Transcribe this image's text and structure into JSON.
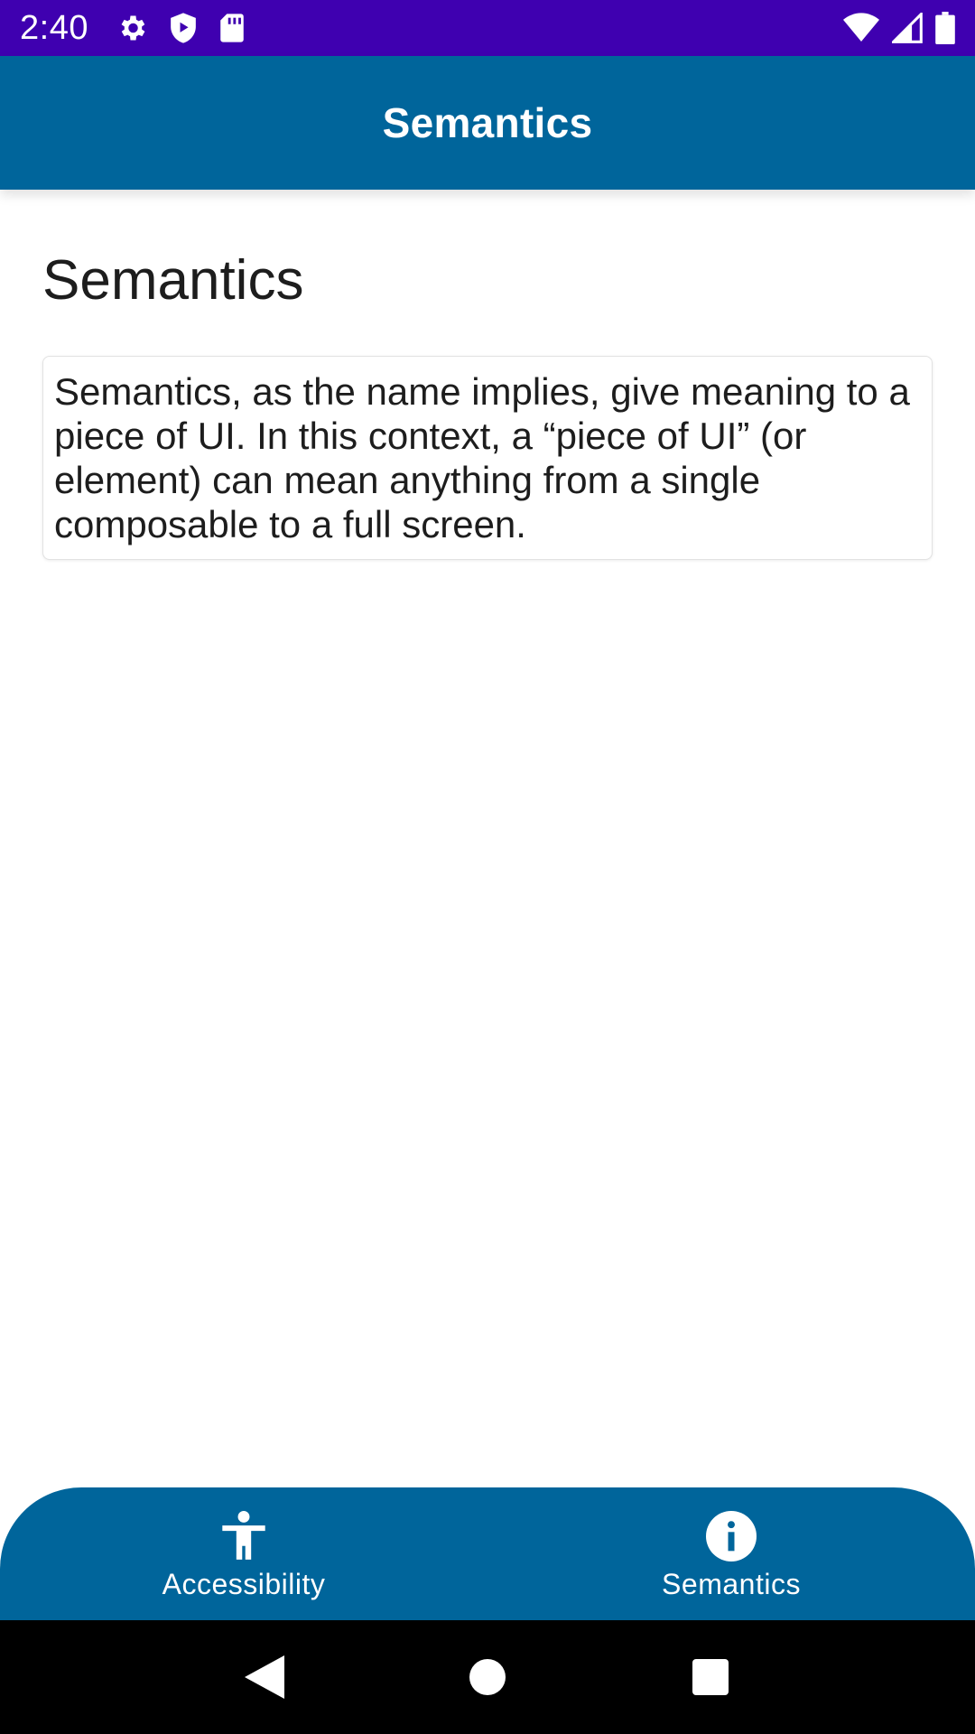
{
  "status_bar": {
    "time": "2:40",
    "left_icons": [
      "settings-icon",
      "shield-play-icon",
      "sd-card-icon"
    ],
    "right_icons": [
      "wifi-icon",
      "cell-signal-icon",
      "battery-icon"
    ],
    "background": "#3f00b0"
  },
  "app_bar": {
    "title": "Semantics",
    "background": "#00659b"
  },
  "main": {
    "heading": "Semantics",
    "card_text": "Semantics, as the name implies, give meaning to a piece of UI. In this context, a “piece of UI” (or element) can mean anything from a single composable to a full screen."
  },
  "bottom_nav": {
    "background": "#00659b",
    "items": [
      {
        "label": "Accessibility",
        "icon": "accessibility-icon",
        "selected": false
      },
      {
        "label": "Semantics",
        "icon": "info-icon",
        "selected": true
      }
    ]
  },
  "system_nav": {
    "buttons": [
      "back-icon",
      "home-icon",
      "recents-icon"
    ]
  }
}
